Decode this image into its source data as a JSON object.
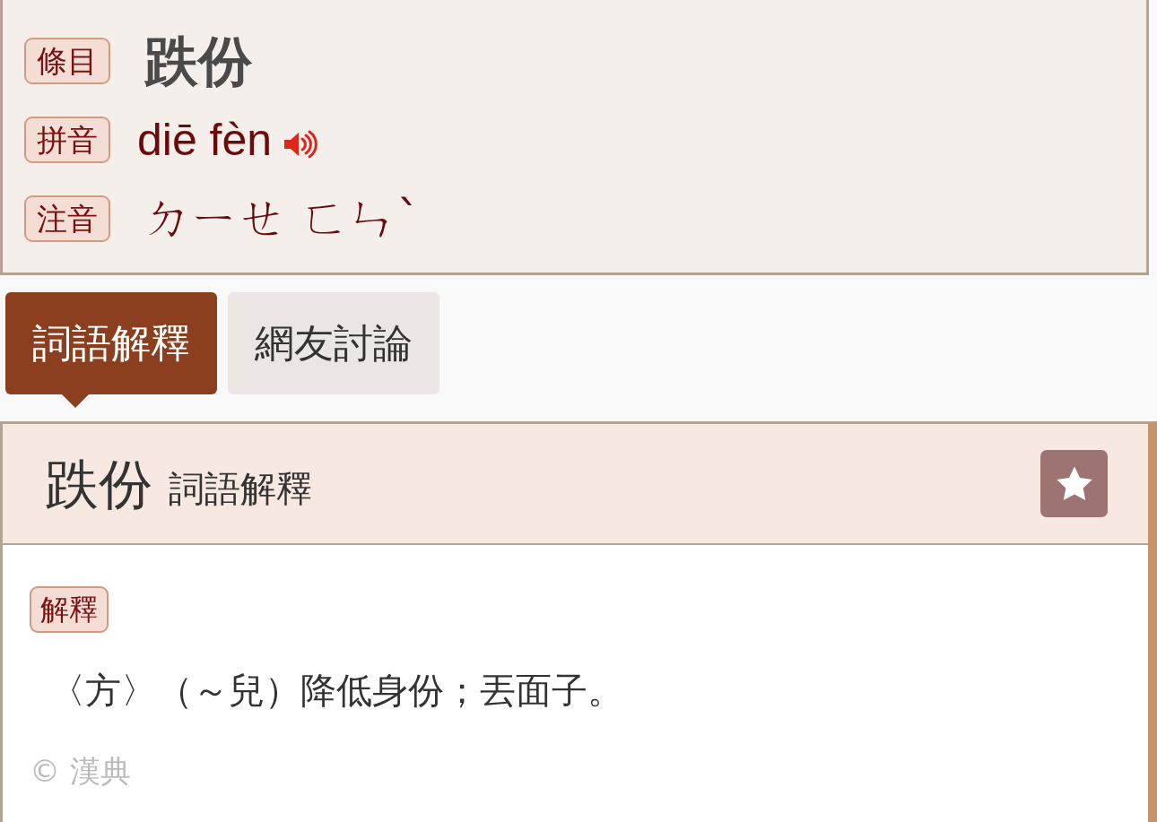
{
  "entry": {
    "fields": [
      {
        "kind": "headword",
        "label": "條目",
        "value": "跌份"
      },
      {
        "kind": "pinyin",
        "label": "拼音",
        "value": "diē fèn"
      },
      {
        "kind": "zhuyin",
        "label": "注音",
        "value": "ㄉㄧㄝ ㄈㄣˋ"
      }
    ]
  },
  "tabs": [
    {
      "label": "詞語解釋",
      "selected": true
    },
    {
      "label": "網友討論",
      "selected": false
    }
  ],
  "panel": {
    "title": "跌份",
    "subtitle": "詞語解釋",
    "sections": [
      {
        "label": "解釋",
        "definition": "〈方〉（～兒）降低身份；丟面子。"
      }
    ],
    "copyright": "© 漢典"
  }
}
